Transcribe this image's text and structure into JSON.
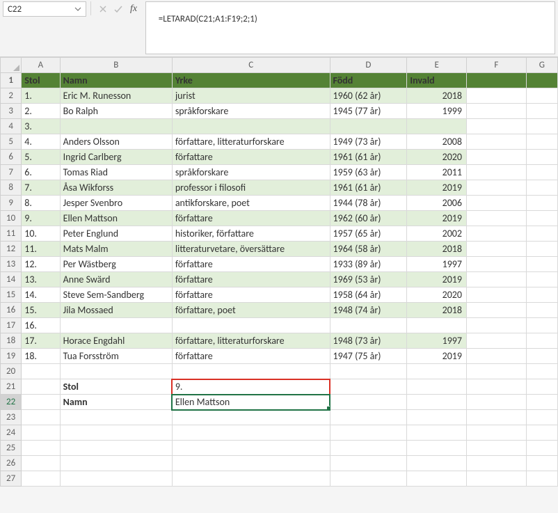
{
  "formula_bar": {
    "cell_ref": "C22",
    "formula": "=LETARAD(C21;A1:F19;2;1)"
  },
  "columns": [
    "A",
    "B",
    "C",
    "D",
    "E",
    "F",
    "G"
  ],
  "header": {
    "A": "Stol",
    "B": "Namn",
    "C": "Yrke",
    "D": "Född",
    "E": "Invald"
  },
  "rows": [
    {
      "n": 2,
      "band": "even",
      "A": "1.",
      "B": "Eric M. Runesson",
      "C": "jurist",
      "D": "1960 (62 år)",
      "E": "2018"
    },
    {
      "n": 3,
      "band": "odd",
      "A": "2.",
      "B": "Bo Ralph",
      "C": "språkforskare",
      "D": "1945 (77 år)",
      "E": "1999"
    },
    {
      "n": 4,
      "band": "even",
      "A": "3.",
      "B": "",
      "C": "",
      "D": "",
      "E": ""
    },
    {
      "n": 5,
      "band": "odd",
      "A": "4.",
      "B": "Anders Olsson",
      "C": "författare, litteraturforskare",
      "D": "1949 (73 år)",
      "E": "2008"
    },
    {
      "n": 6,
      "band": "even",
      "A": "5.",
      "B": "Ingrid Carlberg",
      "C": "författare",
      "D": "1961 (61 år)",
      "E": "2020"
    },
    {
      "n": 7,
      "band": "odd",
      "A": "6.",
      "B": "Tomas Riad",
      "C": "språkforskare",
      "D": "1959 (63 år)",
      "E": "2011"
    },
    {
      "n": 8,
      "band": "even",
      "A": "7.",
      "B": "Åsa Wikforss",
      "C": "professor i filosofi",
      "D": "1961 (61 år)",
      "E": "2019"
    },
    {
      "n": 9,
      "band": "odd",
      "A": "8.",
      "B": "Jesper Svenbro",
      "C": "antikforskare, poet",
      "D": "1944 (78 år)",
      "E": "2006"
    },
    {
      "n": 10,
      "band": "even",
      "A": "9.",
      "B": "Ellen Mattson",
      "C": "författare",
      "D": "1962 (60 år)",
      "E": "2019"
    },
    {
      "n": 11,
      "band": "odd",
      "A": "10.",
      "B": "Peter Englund",
      "C": "historiker, författare",
      "D": "1957 (65 år)",
      "E": "2002"
    },
    {
      "n": 12,
      "band": "even",
      "A": "11.",
      "B": "Mats Malm",
      "C": "litteraturvetare, översättare",
      "D": "1964 (58 år)",
      "E": "2018"
    },
    {
      "n": 13,
      "band": "odd",
      "A": "12.",
      "B": "Per Wästberg",
      "C": "författare",
      "D": "1933 (89 år)",
      "E": "1997"
    },
    {
      "n": 14,
      "band": "even",
      "A": "13.",
      "B": "Anne Swärd",
      "C": "författare",
      "D": "1969 (53 år)",
      "E": "2019"
    },
    {
      "n": 15,
      "band": "odd",
      "A": "14.",
      "B": "Steve Sem-Sandberg",
      "C": "författare",
      "D": "1958 (64 år)",
      "E": "2020"
    },
    {
      "n": 16,
      "band": "even",
      "A": "15.",
      "B": "Jila Mossaed",
      "C": "författare, poet",
      "D": "1948 (74 år)",
      "E": "2018"
    },
    {
      "n": 17,
      "band": "odd",
      "A": "16.",
      "B": "",
      "C": "",
      "D": "",
      "E": ""
    },
    {
      "n": 18,
      "band": "even",
      "A": "17.",
      "B": "Horace Engdahl",
      "C": "författare, litteraturforskare",
      "D": "1948 (73 år)",
      "E": "1997"
    },
    {
      "n": 19,
      "band": "odd",
      "A": "18.",
      "B": "Tua Forsström",
      "C": "författare",
      "D": "1947 (75 år)",
      "E": "2019"
    }
  ],
  "lookup": {
    "r21_label": "Stol",
    "r21_value": "9.",
    "r22_label": "Namn",
    "r22_value": "Ellen Mattson"
  },
  "blank_rows": [
    20,
    23,
    24,
    25,
    26,
    27
  ],
  "active": {
    "col": "C",
    "row": 22
  }
}
